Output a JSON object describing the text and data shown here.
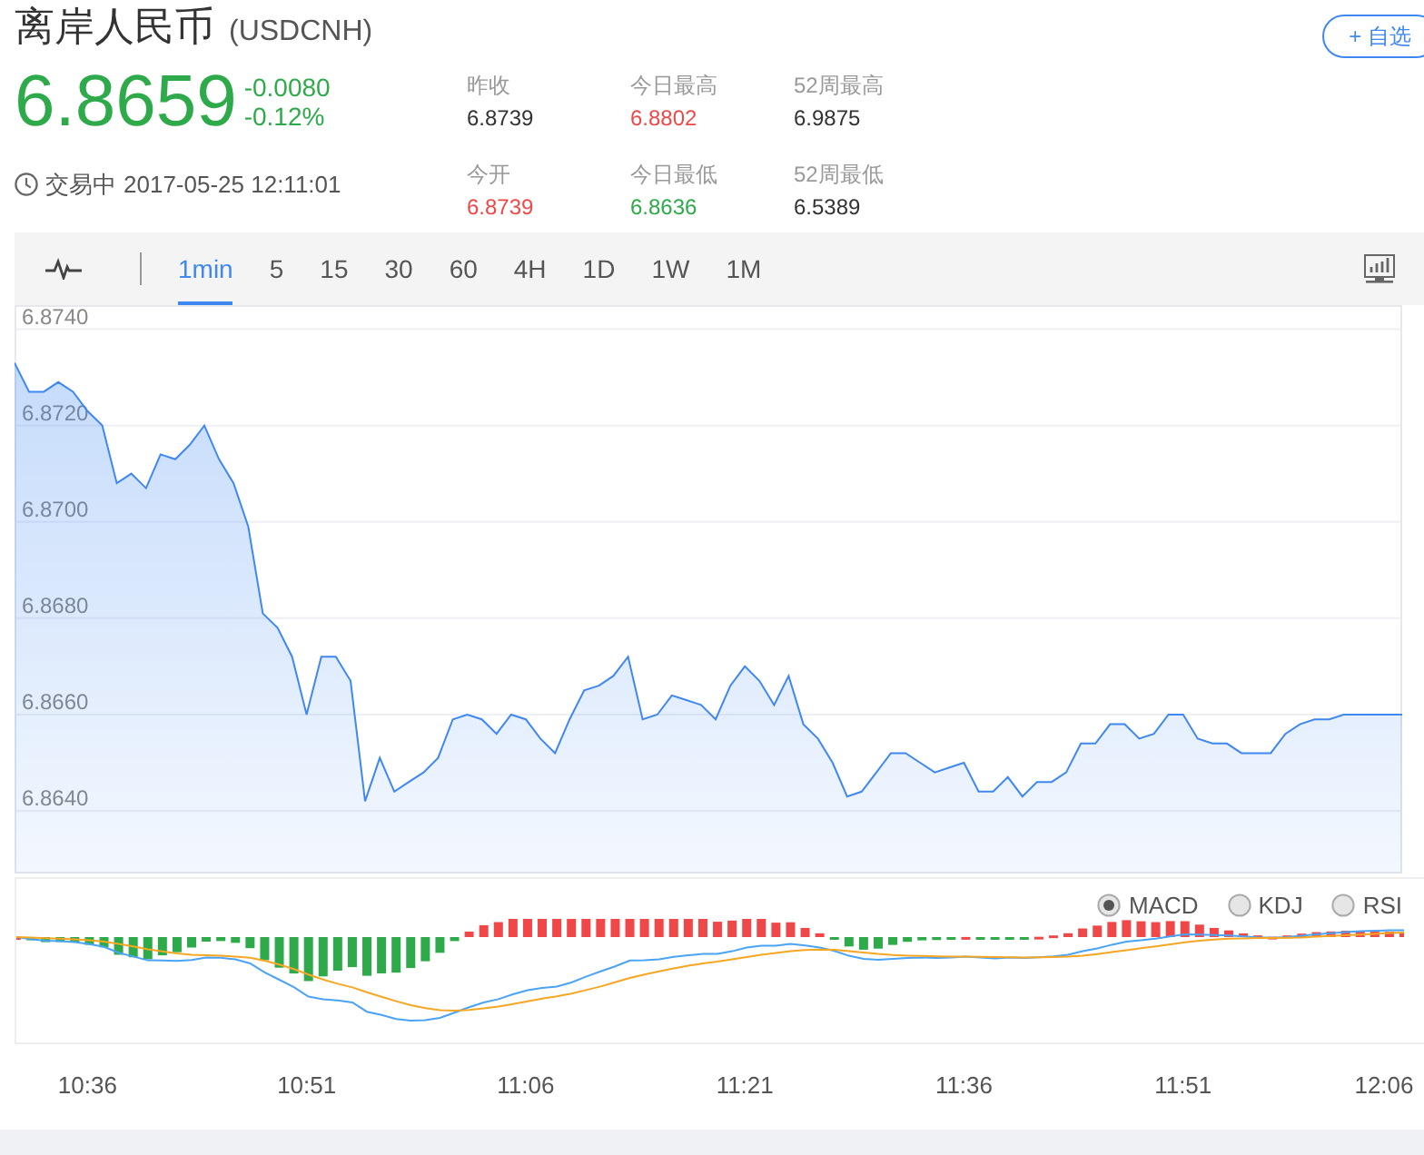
{
  "header": {
    "title": "离岸人民币",
    "symbol": "(USDCNH)",
    "price": "6.8659",
    "change": "-0.0080",
    "change_pct": "-0.12%",
    "status": "交易中",
    "timestamp": "2017-05-25 12:11:01",
    "watch_button": "+ 自选"
  },
  "stats": [
    {
      "label": "昨收",
      "value": "6.8739",
      "color": "#333333"
    },
    {
      "label": "今日最高",
      "value": "6.8802",
      "color": "#f04848"
    },
    {
      "label": "52周最高",
      "value": "6.9875",
      "color": "#333333"
    },
    {
      "label": "今开",
      "value": "6.8739",
      "color": "#f04848"
    },
    {
      "label": "今日最低",
      "value": "6.8636",
      "color": "#2eaa4a"
    },
    {
      "label": "52周最低",
      "value": "6.5389",
      "color": "#333333"
    }
  ],
  "periods": [
    {
      "label": "1min",
      "selected": true
    },
    {
      "label": "5",
      "selected": false
    },
    {
      "label": "15",
      "selected": false
    },
    {
      "label": "30",
      "selected": false
    },
    {
      "label": "60",
      "selected": false
    },
    {
      "label": "4H",
      "selected": false
    },
    {
      "label": "1D",
      "selected": false
    },
    {
      "label": "1W",
      "selected": false
    },
    {
      "label": "1M",
      "selected": false
    }
  ],
  "chart": {
    "chart_data": {
      "type": "area",
      "grid": true,
      "ylim": [
        6.8627,
        6.8745
      ],
      "yticks": [
        {
          "value": 6.874,
          "label": "6.8740"
        },
        {
          "value": 6.872,
          "label": "6.8720"
        },
        {
          "value": 6.87,
          "label": "6.8700"
        },
        {
          "value": 6.868,
          "label": "6.8680"
        },
        {
          "value": 6.866,
          "label": "6.8660"
        },
        {
          "value": 6.864,
          "label": "6.8640"
        }
      ],
      "series": [
        {
          "color": "#3f88f2",
          "values": [
            6.8733,
            6.8727,
            6.8727,
            6.8729,
            6.8727,
            6.8723,
            6.872,
            6.8708,
            6.871,
            6.8707,
            6.8714,
            6.8713,
            6.8716,
            6.872,
            6.8713,
            6.8708,
            6.8699,
            6.8681,
            6.8678,
            6.8672,
            6.866,
            6.8672,
            6.8672,
            6.8667,
            6.8642,
            6.8651,
            6.8644,
            6.8646,
            6.8648,
            6.8651,
            6.8659,
            6.866,
            6.8659,
            6.8656,
            6.866,
            6.8659,
            6.8655,
            6.8652,
            6.8659,
            6.8665,
            6.8666,
            6.8668,
            6.8672,
            6.8659,
            6.866,
            6.8664,
            6.8663,
            6.8662,
            6.8659,
            6.8666,
            6.867,
            6.8667,
            6.8662,
            6.8668,
            6.8658,
            6.8655,
            6.865,
            6.8643,
            6.8644,
            6.8648,
            6.8652,
            6.8652,
            6.865,
            6.8648,
            6.8649,
            6.865,
            6.8644,
            6.8644,
            6.8647,
            6.8643,
            6.8646,
            6.8646,
            6.8648,
            6.8654,
            6.8654,
            6.8658,
            6.8658,
            6.8655,
            6.8656,
            6.866,
            6.866,
            6.8655,
            6.8654,
            6.8654,
            6.8652,
            6.8652,
            6.8652,
            6.8656,
            6.8658,
            6.8659,
            6.8659,
            6.866,
            6.866,
            6.866,
            6.866,
            6.866
          ]
        }
      ]
    }
  },
  "time_axis": [
    "10:36",
    "10:51",
    "11:06",
    "11:21",
    "11:36",
    "11:51",
    "12:06"
  ],
  "indicators": [
    {
      "label": "MACD",
      "selected": true
    },
    {
      "label": "KDJ",
      "selected": false
    },
    {
      "label": "RSI",
      "selected": false
    }
  ]
}
